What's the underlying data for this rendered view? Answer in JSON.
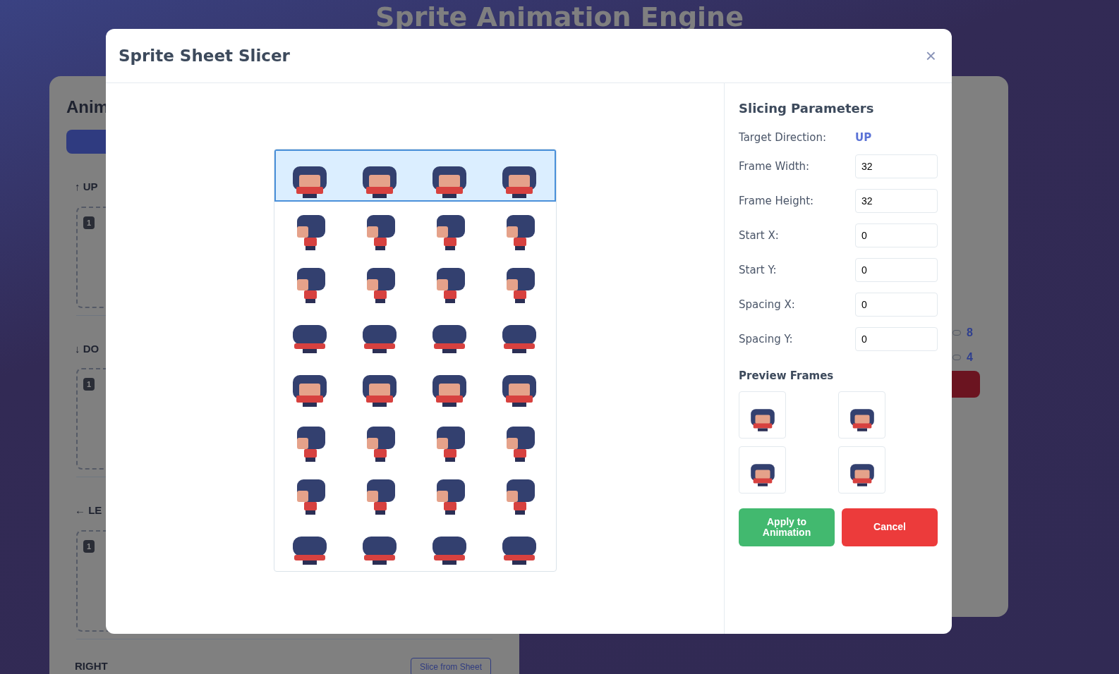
{
  "app_title": "Sprite Animation Engine",
  "background": {
    "panel_heading": "Anim",
    "directions": [
      {
        "label": "↑ UP",
        "frame_badge": "1"
      },
      {
        "label": "↓ DO",
        "frame_badge": "1"
      },
      {
        "label": "← LE",
        "frame_badge": "1"
      },
      {
        "label": "RIGHT",
        "button": "Slice from Sheet"
      }
    ],
    "settings": [
      {
        "value": "8"
      },
      {
        "value": "4"
      }
    ]
  },
  "dialog": {
    "title": "Sprite Sheet Slicer",
    "close": "×",
    "sheet": {
      "rows": [
        {
          "selected": true
        },
        {
          "selected": false
        },
        {
          "selected": false
        },
        {
          "selected": false
        },
        {
          "selected": false
        },
        {
          "selected": false
        },
        {
          "selected": false
        },
        {
          "selected": false
        }
      ]
    },
    "params_title": "Slicing Parameters",
    "target": {
      "label": "Target Direction:",
      "value": "UP"
    },
    "fields": [
      {
        "label": "Frame Width:",
        "value": "32"
      },
      {
        "label": "Frame Height:",
        "value": "32"
      },
      {
        "label": "Start X:",
        "value": "0"
      },
      {
        "label": "Start Y:",
        "value": "0"
      },
      {
        "label": "Spacing X:",
        "value": "0"
      },
      {
        "label": "Spacing Y:",
        "value": "0"
      }
    ],
    "preview_title": "Preview Frames",
    "buttons": [
      {
        "label": "Apply to Animation",
        "kind": "primary"
      },
      {
        "label": "Cancel",
        "kind": "danger"
      }
    ]
  }
}
